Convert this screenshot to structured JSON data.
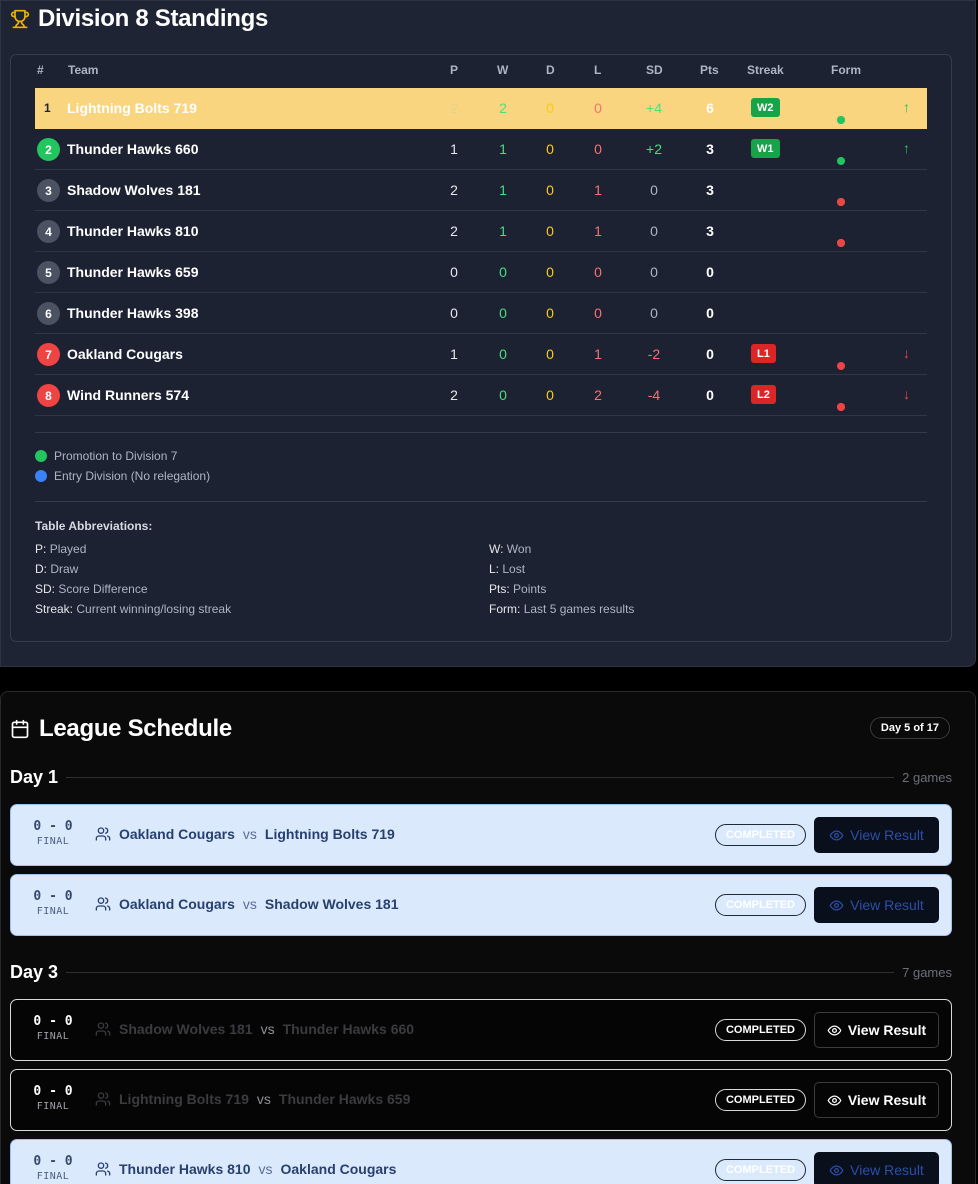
{
  "standings": {
    "title": "Division 8 Standings",
    "columns": {
      "rank": "#",
      "team": "Team",
      "p": "P",
      "w": "W",
      "d": "D",
      "l": "L",
      "sd": "SD",
      "pts": "Pts",
      "streak": "Streak",
      "form": "Form"
    },
    "rows": [
      {
        "rank": "1",
        "team": "Lightning Bolts 719",
        "p": "2",
        "w": "2",
        "d": "0",
        "l": "0",
        "sd": "+4",
        "pts": "6",
        "streak": "W2",
        "form": [
          "W",
          "W"
        ],
        "trend": "up"
      },
      {
        "rank": "2",
        "team": "Thunder Hawks 660",
        "p": "1",
        "w": "1",
        "d": "0",
        "l": "0",
        "sd": "+2",
        "pts": "3",
        "streak": "W1",
        "form": [
          "W"
        ],
        "trend": "up"
      },
      {
        "rank": "3",
        "team": "Shadow Wolves 181",
        "p": "2",
        "w": "1",
        "d": "0",
        "l": "1",
        "sd": "0",
        "pts": "3",
        "streak": "",
        "form": [
          "W",
          "L"
        ],
        "trend": ""
      },
      {
        "rank": "4",
        "team": "Thunder Hawks 810",
        "p": "2",
        "w": "1",
        "d": "0",
        "l": "1",
        "sd": "0",
        "pts": "3",
        "streak": "",
        "form": [
          "W",
          "L"
        ],
        "trend": ""
      },
      {
        "rank": "5",
        "team": "Thunder Hawks 659",
        "p": "0",
        "w": "0",
        "d": "0",
        "l": "0",
        "sd": "0",
        "pts": "0",
        "streak": "",
        "form": [],
        "trend": ""
      },
      {
        "rank": "6",
        "team": "Thunder Hawks 398",
        "p": "0",
        "w": "0",
        "d": "0",
        "l": "0",
        "sd": "0",
        "pts": "0",
        "streak": "",
        "form": [],
        "trend": ""
      },
      {
        "rank": "7",
        "team": "Oakland Cougars",
        "p": "1",
        "w": "0",
        "d": "0",
        "l": "1",
        "sd": "-2",
        "pts": "0",
        "streak": "L1",
        "form": [
          "L"
        ],
        "trend": "down"
      },
      {
        "rank": "8",
        "team": "Wind Runners 574",
        "p": "2",
        "w": "0",
        "d": "0",
        "l": "2",
        "sd": "-4",
        "pts": "0",
        "streak": "L2",
        "form": [
          "L",
          "L"
        ],
        "trend": "down"
      }
    ],
    "legend": [
      {
        "label": "Promotion to Division 7",
        "color": "#22c55e"
      },
      {
        "label": "Entry Division (No relegation)",
        "color": "#3b82f6"
      }
    ],
    "abbreviations": {
      "title": "Table Abbreviations:",
      "items": [
        {
          "key": "P:",
          "value": "Played"
        },
        {
          "key": "W:",
          "value": "Won"
        },
        {
          "key": "D:",
          "value": "Draw"
        },
        {
          "key": "L:",
          "value": "Lost"
        },
        {
          "key": "SD:",
          "value": "Score Difference"
        },
        {
          "key": "Pts:",
          "value": "Points"
        },
        {
          "key": "Streak:",
          "value": "Current winning/losing streak"
        },
        {
          "key": "Form:",
          "value": "Last 5 games results"
        }
      ]
    },
    "colors": {
      "leader_row": "#f8d57e",
      "win": "#22c55e",
      "loss": "#ef4444",
      "draw": "#facc15"
    }
  },
  "schedule": {
    "title": "League Schedule",
    "day_badge": "Day 5 of 17",
    "days": [
      {
        "label": "Day 1",
        "count": "2 games",
        "matches": [
          {
            "score": "0 - 0",
            "final": "FINAL",
            "home": "Oakland Cougars",
            "vs": "vs",
            "away": "Lightning Bolts 719",
            "status": "COMPLETED",
            "action": "View Result",
            "highlight": true
          },
          {
            "score": "0 - 0",
            "final": "FINAL",
            "home": "Oakland Cougars",
            "vs": "vs",
            "away": "Shadow Wolves 181",
            "status": "COMPLETED",
            "action": "View Result",
            "highlight": true
          }
        ]
      },
      {
        "label": "Day 3",
        "count": "7 games",
        "matches": [
          {
            "score": "0 - 0",
            "final": "FINAL",
            "home": "Shadow Wolves 181",
            "vs": "vs",
            "away": "Thunder Hawks 660",
            "status": "COMPLETED",
            "action": "View Result",
            "highlight": false
          },
          {
            "score": "0 - 0",
            "final": "FINAL",
            "home": "Lightning Bolts 719",
            "vs": "vs",
            "away": "Thunder Hawks 659",
            "status": "COMPLETED",
            "action": "View Result",
            "highlight": false
          },
          {
            "score": "0 - 0",
            "final": "FINAL",
            "home": "Thunder Hawks 810",
            "vs": "vs",
            "away": "Oakland Cougars",
            "status": "COMPLETED",
            "action": "View Result",
            "highlight": true
          }
        ]
      }
    ]
  }
}
